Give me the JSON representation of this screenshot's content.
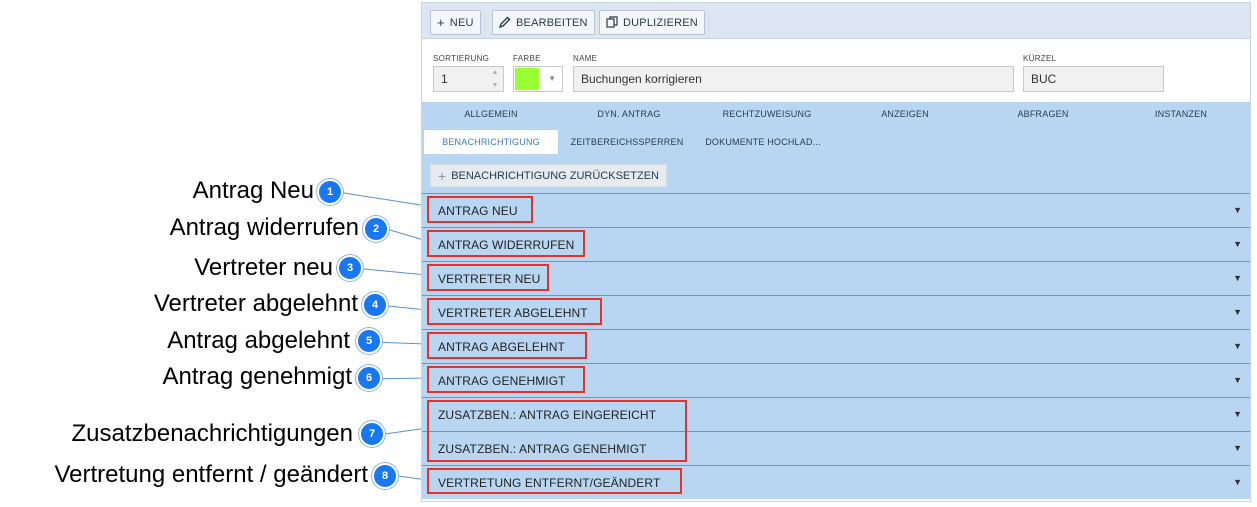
{
  "toolbar": {
    "new": "NEU",
    "edit": "BEARBEITEN",
    "duplicate": "DUPLIZIEREN"
  },
  "fields": {
    "sort_label": "SORTIERUNG",
    "sort_value": "1",
    "color_label": "FARBE",
    "color_value": "#99ff33",
    "name_label": "NAME",
    "name_value": "Buchungen korrigieren",
    "short_label": "KÜRZEL",
    "short_value": "BUC"
  },
  "tabs": {
    "row1": [
      "ALLGEMEIN",
      "DYN. ANTRAG",
      "RECHTZUWEISUNG",
      "ANZEIGEN",
      "ABFRAGEN",
      "INSTANZEN"
    ],
    "row2": [
      "BENACHRICHTIGUNG",
      "ZEITBEREICHSSPERREN",
      "DOKUMENTE HOCHLAD..."
    ],
    "active": "BENACHRICHTIGUNG"
  },
  "reset_button": "BENACHRICHTIGUNG ZURÜCKSETZEN",
  "sections": [
    "ANTRAG NEU",
    "ANTRAG WIDERRUFEN",
    "VERTRETER NEU",
    "VERTRETER ABGELEHNT",
    "ANTRAG ABGELEHNT",
    "ANTRAG GENEHMIGT",
    "ZUSATZBEN.: ANTRAG EINGEREICHT",
    "ZUSATZBEN.: ANTRAG GENEHMIGT",
    "VERTRETUNG ENTFERNT/GEÄNDERT"
  ],
  "callouts": [
    {
      "num": "1",
      "label": "Antrag Neu"
    },
    {
      "num": "2",
      "label": "Antrag widerrufen"
    },
    {
      "num": "3",
      "label": "Vertreter neu"
    },
    {
      "num": "4",
      "label": "Vertreter abgelehnt"
    },
    {
      "num": "5",
      "label": "Antrag abgelehnt"
    },
    {
      "num": "6",
      "label": "Antrag genehmigt"
    },
    {
      "num": "7",
      "label": "Zusatzbenachrichtigungen"
    },
    {
      "num": "8",
      "label": "Vertretung entfernt / geändert"
    }
  ],
  "colors": {
    "accent": "#1877f2",
    "highlight": "#e2342d",
    "section_bg": "#b8d6f2",
    "active_tab_text": "#3b7fbf"
  },
  "icons": {
    "new": "plus-icon",
    "edit": "pencil-icon",
    "duplicate": "copy-icon",
    "expand": "caret-down-icon"
  }
}
